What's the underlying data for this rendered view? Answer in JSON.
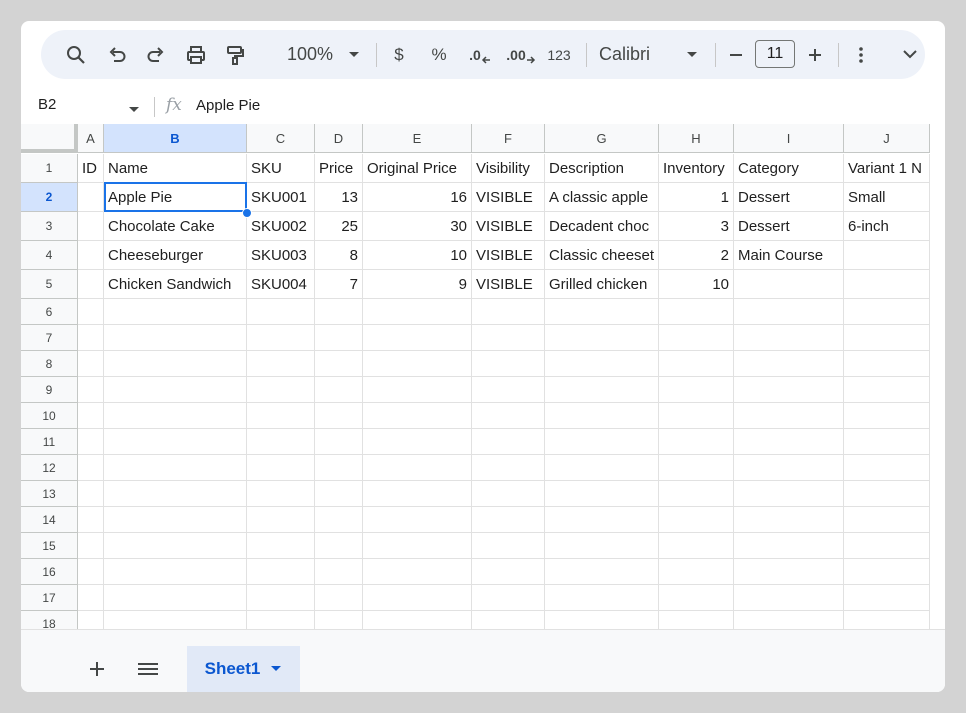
{
  "toolbar": {
    "zoom": "100%",
    "currency": "$",
    "percent": "%",
    "dec_decrease": ".0",
    "dec_increase": ".00",
    "number_format": "123",
    "font": "Calibri",
    "font_size": "11"
  },
  "formula_bar": {
    "cell_ref": "B2",
    "fx": "fx",
    "content": "Apple Pie"
  },
  "columns": [
    "A",
    "B",
    "C",
    "D",
    "E",
    "F",
    "G",
    "H",
    "I",
    "J"
  ],
  "row_numbers": [
    "1",
    "2",
    "3",
    "4",
    "5",
    "6",
    "7",
    "8",
    "9",
    "10",
    "11",
    "12",
    "13",
    "14",
    "15",
    "16",
    "17",
    "18"
  ],
  "rows": [
    [
      "ID",
      "Name",
      "SKU",
      "Price",
      "Original Price",
      "Visibility",
      "Description",
      "Inventory",
      "Category",
      "Variant 1 N"
    ],
    [
      "",
      "Apple Pie",
      "SKU001",
      "13",
      "16",
      "VISIBLE",
      "A classic apple",
      "1",
      "Dessert",
      "Small"
    ],
    [
      "",
      "Chocolate Cake",
      "SKU002",
      "25",
      "30",
      "VISIBLE",
      "Decadent choc",
      "3",
      "Dessert",
      "6-inch"
    ],
    [
      "",
      "Cheeseburger",
      "SKU003",
      "8",
      "10",
      "VISIBLE",
      "Classic cheeset",
      "2",
      "Main Course",
      ""
    ],
    [
      "",
      "Chicken Sandwich",
      "SKU004",
      "7",
      "9",
      "VISIBLE",
      "Grilled chicken",
      "10",
      "",
      ""
    ]
  ],
  "sheets": [
    {
      "name": "Sheet1",
      "active": true
    }
  ],
  "colors": {
    "accent": "#0b57d0",
    "selection": "#1a73e8",
    "header_selected": "#d3e3fd"
  }
}
